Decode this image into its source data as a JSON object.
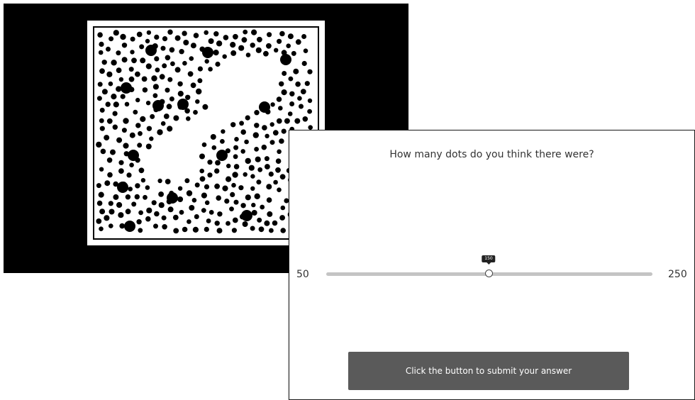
{
  "stimulus": {
    "background_color": "#000000",
    "dot_color": "#000000"
  },
  "question": {
    "text": "How many dots do you think there were?"
  },
  "slider": {
    "min_label": "50",
    "max_label": "250",
    "min": 50,
    "max": 250,
    "value": 150,
    "value_label": "150",
    "track_color": "#c4c4c4"
  },
  "submit_button": {
    "label": "Click the button to submit your answer",
    "color": "#5a5a5a"
  }
}
